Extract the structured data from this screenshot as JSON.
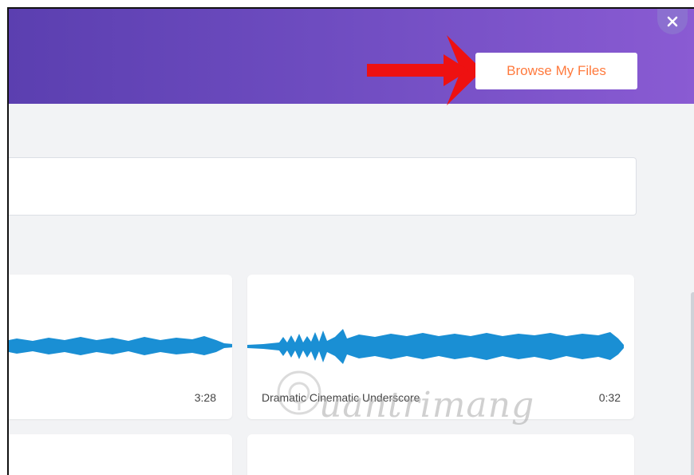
{
  "header": {
    "browse_label": "Browse My Files",
    "accent_color": "#ff7a3d",
    "gradient_start": "#5b3fb0",
    "gradient_end": "#8a5bd3"
  },
  "close_icon": "close-icon",
  "tracks": [
    {
      "title": "",
      "duration": "3:28"
    },
    {
      "title": "Dramatic Cinematic Underscore",
      "duration": "0:32"
    }
  ],
  "watermark": {
    "text": "uantrimang"
  }
}
